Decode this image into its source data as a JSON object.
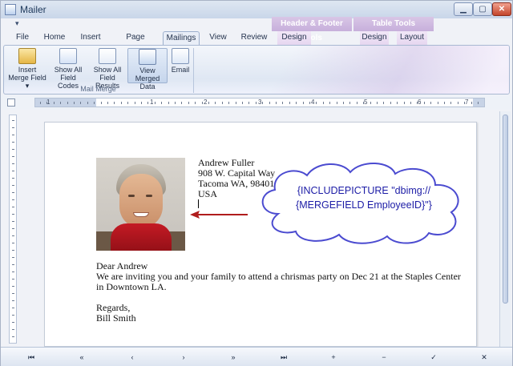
{
  "window": {
    "title": "Mailer",
    "min_glyph": "▁",
    "max_glyph": "▢",
    "close_glyph": "✕"
  },
  "qat": {
    "glyph": "▾"
  },
  "context_groups": {
    "header_footer": "Header & Footer Tools",
    "table": "Table Tools"
  },
  "tabs": [
    "File",
    "Home",
    "Insert",
    "Page Layout",
    "Mailings",
    "View",
    "Review",
    "Design",
    "Design",
    "Layout"
  ],
  "active_tab": "Mailings",
  "ribbon": {
    "buttons": [
      {
        "line1": "Insert",
        "line2": "Merge Field ▾",
        "icon": "insert-merge-field-icon"
      },
      {
        "line1": "Show All",
        "line2": "Field Codes",
        "icon": "field-codes-icon"
      },
      {
        "line1": "Show All",
        "line2": "Field Results",
        "icon": "field-results-icon"
      },
      {
        "line1": "View Merged",
        "line2": "Data",
        "icon": "view-merged-data-icon"
      },
      {
        "line1": "Email",
        "line2": "",
        "icon": "email-icon"
      }
    ],
    "group_label": "Mail Merge"
  },
  "ruler": {
    "numbers": [
      "1",
      "1",
      "2",
      "3",
      "4",
      "5",
      "6",
      "7"
    ]
  },
  "document": {
    "address": [
      "Andrew Fuller",
      "908 W. Capital Way",
      "Tacoma WA, 98401",
      "USA"
    ],
    "greeting": "Dear Andrew",
    "body": "We are inviting you and your family to attend a chrismas party on Dec 21 at the Staples Center in Downtown LA.",
    "closing": "Regards,",
    "signature": "Bill Smith"
  },
  "callout": {
    "line1": "{INCLUDEPICTURE \"dbimg://",
    "line2": "{MERGEFIELD EmployeeID}\"}"
  },
  "navigator": {
    "first": "⏮",
    "prev_page": "«",
    "prev": "‹",
    "next": "›",
    "next_page": "»",
    "last": "⏭",
    "add": "+",
    "remove": "−",
    "apply": "✓",
    "cancel": "✕"
  },
  "colors": {
    "callout_text": "#1c1ca6",
    "arrow": "#b01c1c",
    "accent": "#c7afdb"
  }
}
